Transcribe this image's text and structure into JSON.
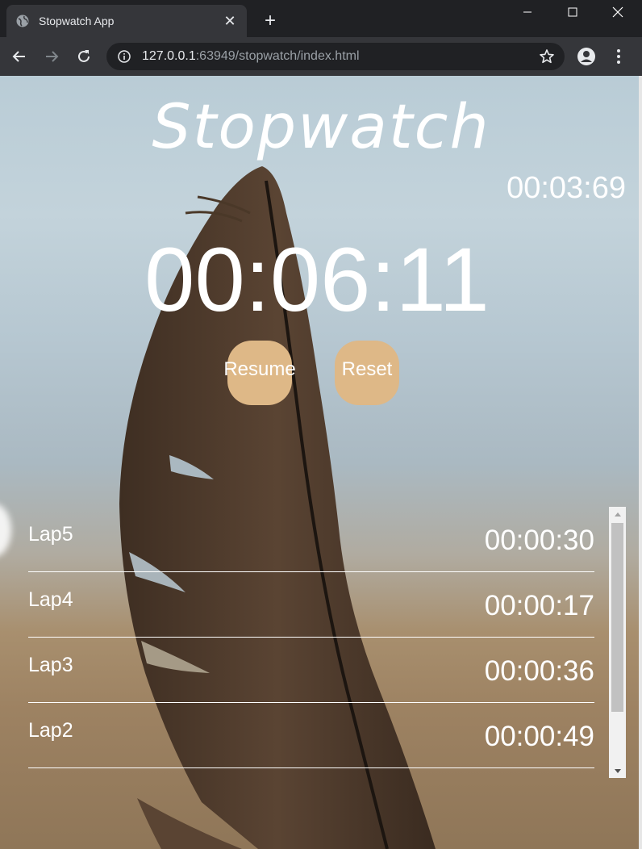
{
  "browser": {
    "tab_title": "Stopwatch App",
    "tab_close": "✕",
    "new_tab": "+",
    "url_host": "127.0.0.1",
    "url_rest": ":63949/stopwatch/index.html"
  },
  "app": {
    "title": "Stopwatch",
    "lap_timer": "00:03:69",
    "main_timer": "00:06:11",
    "resume_label": "Resume",
    "reset_label": "Reset"
  },
  "laps": [
    {
      "name": "Lap5",
      "time": "00:00:30"
    },
    {
      "name": "Lap4",
      "time": "00:00:17"
    },
    {
      "name": "Lap3",
      "time": "00:00:36"
    },
    {
      "name": "Lap2",
      "time": "00:00:49"
    }
  ],
  "colors": {
    "button_bg": "#deb887",
    "chrome_dark": "#202124",
    "chrome_toolbar": "#35363a"
  },
  "icons": [
    "globe-icon",
    "close-icon",
    "plus-icon",
    "minimize-icon",
    "maximize-icon",
    "window-close-icon",
    "back-arrow-icon",
    "forward-arrow-icon",
    "reload-icon",
    "info-icon",
    "star-icon",
    "profile-icon",
    "kebab-menu-icon"
  ]
}
